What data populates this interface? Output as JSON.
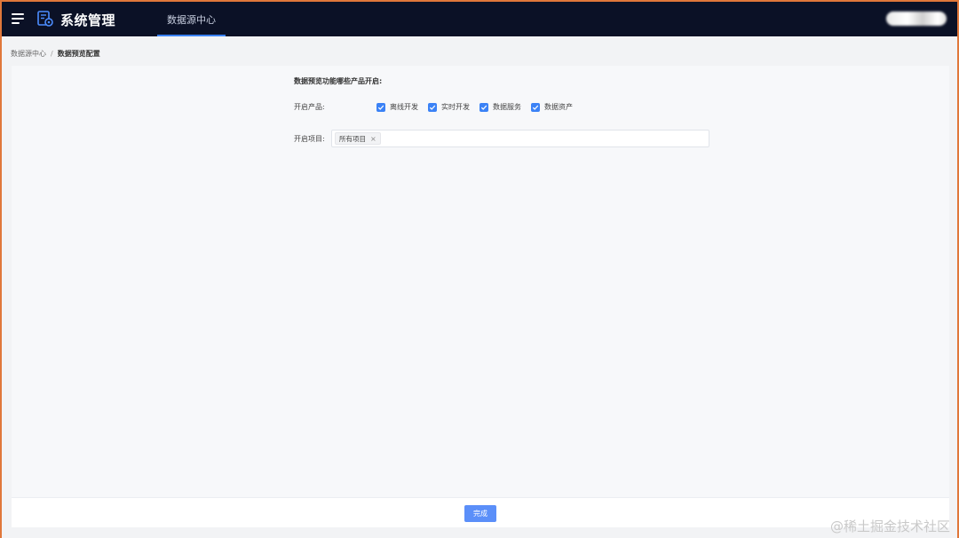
{
  "header": {
    "title": "系统管理",
    "active_tab": "数据源中心"
  },
  "breadcrumb": {
    "parent": "数据源中心",
    "separator": "/",
    "current": "数据预览配置"
  },
  "form": {
    "section_title": "数据预览功能哪些产品开启:",
    "product_label": "开启产品:",
    "products": [
      {
        "label": "离线开发",
        "checked": true
      },
      {
        "label": "实时开发",
        "checked": true
      },
      {
        "label": "数据服务",
        "checked": true
      },
      {
        "label": "数据资产",
        "checked": true
      }
    ],
    "project_label": "开启项目:",
    "project_tag": "所有项目",
    "tag_close": "×"
  },
  "footer": {
    "done_label": "完成"
  },
  "watermark": "@稀土掘金技术社区",
  "colors": {
    "topbar": "#0b1126",
    "accent": "#3b82f6",
    "button": "#5b8ff9"
  }
}
